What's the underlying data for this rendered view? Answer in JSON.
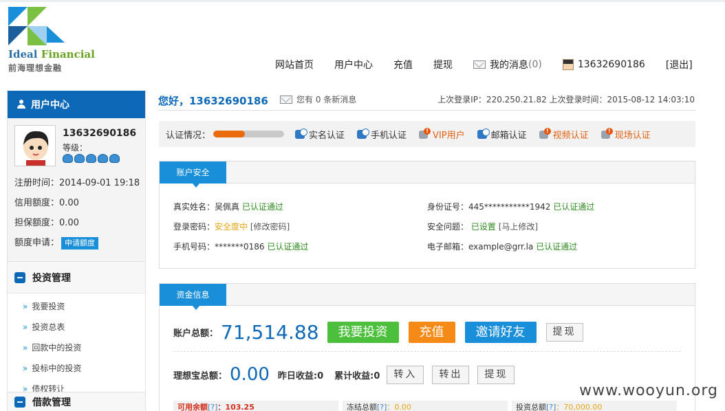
{
  "header": {
    "logo_en_1": "Ideal",
    "logo_en_2": "Financial",
    "logo_cn": "前海理想金融",
    "nav": {
      "home": "网站首页",
      "user_center": "用户中心",
      "recharge": "充值",
      "withdraw": "提现",
      "messages": "我的消息",
      "messages_count": "(0)",
      "username": "13632690186",
      "logout": "[退出]"
    }
  },
  "sidebar": {
    "title": "用户中心",
    "username": "13632690186",
    "level_label": "等级：",
    "reg_time": "注册时间：2014-09-01 19:18",
    "credit_limit": "信用额度：0.00",
    "guarantee_limit": "担保额度：0.00",
    "limit_apply_label": "额度申请：",
    "limit_apply_button": "申请额度",
    "invest_section": "投资管理",
    "invest_items": [
      "我要投资",
      "投资总表",
      "回款中的投资",
      "投标中的投资",
      "债权转让"
    ],
    "loan_section": "借款管理"
  },
  "main": {
    "greeting": "您好，13632690186",
    "message_note": "您有 0 条新消息",
    "last_login": "上次登录IP：220.250.21.82   上次登录时间：2015-08-12 14:03:10",
    "auth": {
      "label": "认证情况：",
      "progress": 0.45,
      "items": {
        "real_name": "实名认证",
        "phone": "手机认证",
        "vip": "VIP用户",
        "email": "邮箱认证",
        "video": "视频认证",
        "onsite": "现场认证"
      }
    },
    "security": {
      "tab": "账户安全",
      "real_name_label": "真实姓名：吴佩真",
      "real_name_status": "已认证通过",
      "password_label": "登录密码：",
      "password_status": "安全度中",
      "password_link": "[修改密码]",
      "phone_label": "手机号码：*******0186",
      "phone_status": "已认证通过",
      "id_label": "身份证号：445***********1942",
      "id_status": "已认证通过",
      "question_label": "安全问题：",
      "question_status": "已设置",
      "question_link": "[马上修改]",
      "email_label": "电子邮箱：example@grr.la",
      "email_status": "已认证通过"
    },
    "funds": {
      "tab": "资金信息",
      "total_label": "账户总额：",
      "total_value": "71,514.88",
      "invest_button": "我要投资",
      "recharge_button": "充值",
      "invite_button": "邀请好友",
      "withdraw_button": "提现",
      "lxb_label": "理想宝总额：",
      "lxb_value": "0.00",
      "yesterday_label": "昨日收益:0",
      "cumulative_label": "累计收益:0",
      "transfer_in": "转入",
      "transfer_out": "转出",
      "lxb_withdraw": "提现",
      "stats": {
        "available_label": "可用余额",
        "available_q": "[?]",
        "available_value": "：103.25",
        "frozen_label": "冻结总额",
        "frozen_q": "[?]",
        "frozen_value": "：0.00",
        "invest_label": "投资总额",
        "invest_q": "[?]",
        "invest_value": "：70,000.00"
      }
    }
  },
  "watermark": "www.wooyun.org"
}
